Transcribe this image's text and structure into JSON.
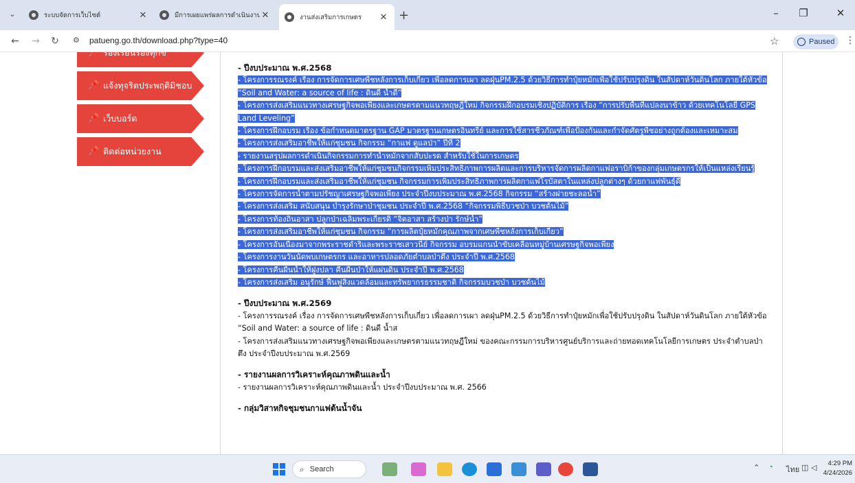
{
  "tabs": [
    {
      "title": "ระบบจัดการเว็บไซต์",
      "active": false
    },
    {
      "title": "มีการเผยแพร่ผลการดำเนินงาน",
      "active": false
    },
    {
      "title": "งานส่งเสริมการเกษตร",
      "active": true
    }
  ],
  "toolbar": {
    "url": "patueng.go.th/download.php?type=40",
    "profile_label": "Paused"
  },
  "sidebar": {
    "items": [
      {
        "label": "ร้องเรียนร้องทุกข์"
      },
      {
        "label": "แจ้งทุจริตประพฤติมิชอบ"
      },
      {
        "label": "เว็บบอร์ด"
      },
      {
        "label": "ติดต่อหน่วยงาน"
      }
    ]
  },
  "content": {
    "section_2568": {
      "heading": "- ปีงบประมาณ พ.ศ.2568",
      "entries": [
        "- โครงการรณรงค์ เรื่อง การจัดการเศษพืชหลังการเก็บเกี่ยว เพื่อลดการเผา ลดฝุ่นPM.2.5 ด้วยวิธีการทำปุ๋ยหมักเพื่อใช้ปรับปรุงดิน ในสัปดาห์วันดินโลก ภายใต้หัวข้อ “Soil and Water: a source of life : ดินดี น้ำดี”",
        "- โครงการส่งเสริมแนวทางเศรษฐกิจพอเพียงและเกษตรตามแนวทฤษฎีใหม่ กิจกรรมฝึกอบรมเชิงปฏิบัติการ เรื่อง “การปรับพื้นที่แปลงนาข้าว ด้วยเทคโนโลยี GPS Land Leveling”",
        "- โครงการฝึกอบรม เรื่อง ข้อกำหนดมาตรฐาน GAP มาตรฐานเกษตรอินทรีย์ และการใช้สารชีวภัณฑ์เพื่อป้องกันและกำจัดศัตรูพืชอย่างถูกต้องและเหมาะสม",
        "- โครงการส่งเสริมอาชีพให้แก่ชุมชน กิจกรรม “กาแฟ ดูแลป่า” ปีที่ 2",
        "- รายงานสรุปผลการดำเนินกิจกรรมการทำน้ำหมักจากสับปะรด สำหรับใช้ในการเกษตร",
        "- โครงการฝึกอบรมและส่งเสริมอาชีพให้แก่ชุมชนกิจกรรมเพิ่มประสิทธิภาพการผลิตและการบริหารจัดการผลิตกาแฟอราบิก้าของกลุ่มเกษตรกรให้เป็นแหล่งเรียนรู้",
        "- โครงการฝึกอบรมและส่งเสริมอาชีพให้แก่ชุมชน กิจกรรมการเพิ่มประสิทธิภาพการผลิตกาแฟโรบัสตาในแหล่งปลูกต่างๆ ด้วยกาแฟพันธุ์ดี",
        "- โครงการจัดการน้ำตามปรัชญาเศรษฐกิจพอเพียง ประจำปีงบประมาณ พ.ศ.2568 กิจกรรม “สร้างฝายชะลอน้ำ”",
        "- โครงการส่งเสริม สนับสนุน บำรุงรักษาป่าชุมชน ประจำปี พ.ศ.2568 “กิจกรรมพิธีบวชป่า บวชต้นไม้”",
        "- โครงการท้องถิ่นอาสา ปลูกป่าเฉลิมพระเกียรติ “จิตอาสา สร้างป่า รักษ์น้ำ”",
        "- โครงการส่งเสริมอาชีพให้แก่ชุมชน กิจกรรม “การผลิตปุ๋ยหมักคุณภาพจากเศษพืชหลังการเก็บเกี่ยว”",
        "- โครงการอันเนื่องมาจากพระราชดำริและพระราชเสาวนีย์ กิจกรรม อบรมแกนนำขับเคลื่อนหมู่บ้านเศรษฐกิจพอเพียง",
        "- โครงการงานวันนัดพบเกษตรกร และอาหารปลอดภัยตำบลป่าตึง ประจำปี พ.ศ.2568",
        "- โครงการคืนผืนน้ำให้ฝูงปลา คืนผืนป่าให้แผ่นดิน ประจำปี พ.ศ.2568",
        "- โครงการส่งเสริม อนุรักษ์ ฟื้นฟูสิ่งแวดล้อมและทรัพยากรธรรมชาติ กิจกรรมบวชป่า บวชต้นไม้"
      ]
    },
    "section_2569": {
      "heading": "- ปีงบประมาณ พ.ศ.2569",
      "entries": [
        "- โครงการรณรงค์ เรื่อง การจัดการเศษพืชหลังการเก็บเกี่ยว เพื่อลดการเผา ลดฝุ่นPM.2.5 ด้วยวิธีการทำปุ๋ยหมักเพื่อใช้ปรับปรุงดิน ในสัปดาห์วันดินโลก ภายใต้หัวข้อ “Soil and Water: a source of life : ดินดี น้ำส",
        "- โครงการส่งเสริมแนวทางเศรษฐกิจพอเพียงและเกษตรตามแนวทฤษฎีใหม่ ของคณะกรรมการบริหารศูนย์บริการและถ่ายทอดเทคโนโลยีการเกษตร ประจำตำบลป่าตึง ประจำปีงบประมาณ พ.ศ.2569"
      ]
    },
    "section_soil": {
      "heading": "- รายงานผลการวิเคราะห์คุณภาพดินและน้ำ",
      "entries": [
        "- รายงานผลการวิเคราะห์คุณภาพดินและน้ำ ประจำปีงบประมาณ พ.ศ. 2566"
      ]
    },
    "section_coffee": {
      "heading": "- กลุ่มวิสาหกิจชุมชนกาแฟต้นน้ำจัน"
    }
  },
  "taskbar": {
    "search_placeholder": "Search",
    "language": "ไทย",
    "time": "4:29 PM",
    "date": "4/24/2026"
  },
  "colors": {
    "accent_red": "#e5443d",
    "selection_blue": "#3c67d6"
  }
}
